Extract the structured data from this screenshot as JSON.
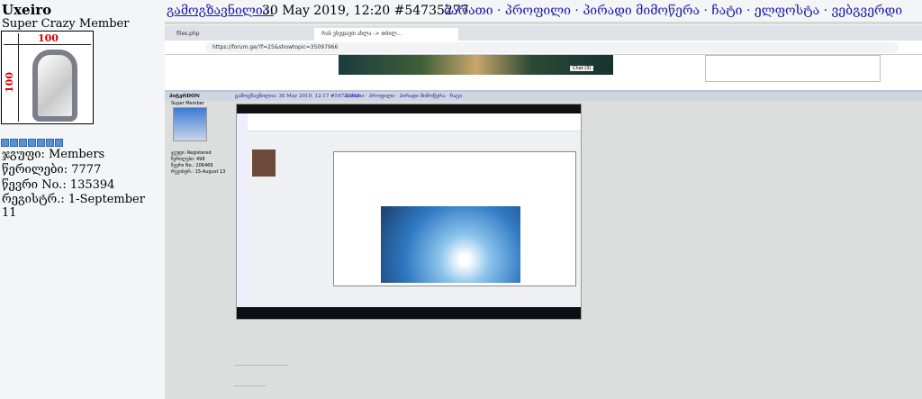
{
  "profile": {
    "username": "Uxeiro",
    "rank": "Super Crazy Member",
    "avatar_label": "100",
    "pips": 7,
    "stats": [
      "ჯგუფი: Members",
      "წერილები: 7777",
      "წევრი No.: 135394",
      "რეგისტრ.: 1-September 11"
    ]
  },
  "post": {
    "posted_label": "გამოგზავნილია:",
    "date": "30 May 2019, 12:20  #54735277",
    "nav": "ბარათი · პროფილი · პირადი მიმოწერა · ჩატი · ელფოსტა · ვებგვერდი"
  },
  "screenshot": {
    "tab1": "files.php",
    "tab2": "რას ვხედავთ ახლა -> თბილ...",
    "url": "https://forum.ge/?f=25&showtopic=35097966",
    "chat": "Chat (3)",
    "author": "პიტერDON",
    "author_rank": "Super Member",
    "inner_date": "გამოგზავნილია: 30 May 2019, 12:17  #54735265",
    "inner_nav": "ბარათი · პროფილი · პირადი მიმოწერა · ჩატი",
    "inner_stats": [
      "ჯგუფი: Registered",
      "წერილები: 498",
      "წევრი No.: 206466",
      "რეგისტრ.: 15-August 13"
    ]
  }
}
